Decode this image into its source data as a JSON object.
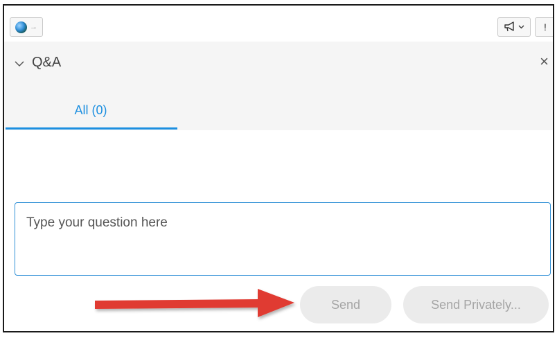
{
  "toolbar": {
    "status_icon": "globe-icon",
    "announce_icon": "megaphone-icon",
    "alert_label": "!"
  },
  "panel": {
    "title": "Q&A",
    "close_glyph": "×"
  },
  "tabs": [
    {
      "label": "All (0)",
      "selected": true
    }
  ],
  "question": {
    "placeholder": "Type your question here",
    "value": ""
  },
  "buttons": {
    "send": "Send",
    "send_privately": "Send Privately..."
  },
  "colors": {
    "accent": "#1c8fe0",
    "annotation_arrow": "#e03a32",
    "disabled_text": "#a5a5a5",
    "disabled_bg": "#ebebeb"
  }
}
